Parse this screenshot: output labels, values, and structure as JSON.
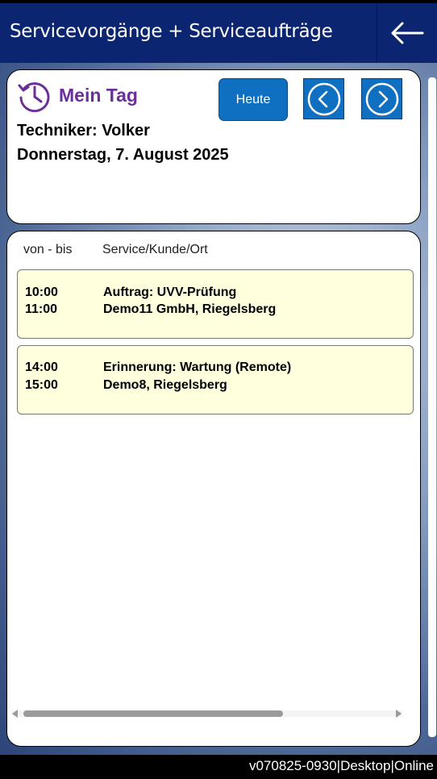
{
  "header": {
    "title": "Servicevorgänge + Serviceaufträge",
    "back_icon": "arrow-left-icon"
  },
  "day_card": {
    "heading": "Mein Tag",
    "today_button": "Heute",
    "technician": "Techniker: Volker",
    "date": "Donnerstag, 7. August 2025",
    "accent_color": "#6b2f9a",
    "button_color": "#0f6fc0"
  },
  "schedule": {
    "col_time": "von - bis",
    "col_service": "Service/Kunde/Ort",
    "items": [
      {
        "from": "10:00",
        "to": "11:00",
        "title": "Auftrag: UVV-Prüfung",
        "customer": "Demo11 GmbH, Riegelsberg"
      },
      {
        "from": "14:00",
        "to": "15:00",
        "title": "Erinnerung: Wartung (Remote)",
        "customer": "Demo8, Riegelsberg"
      }
    ]
  },
  "footer": {
    "version": "v070825-0930|Desktop|Online"
  }
}
